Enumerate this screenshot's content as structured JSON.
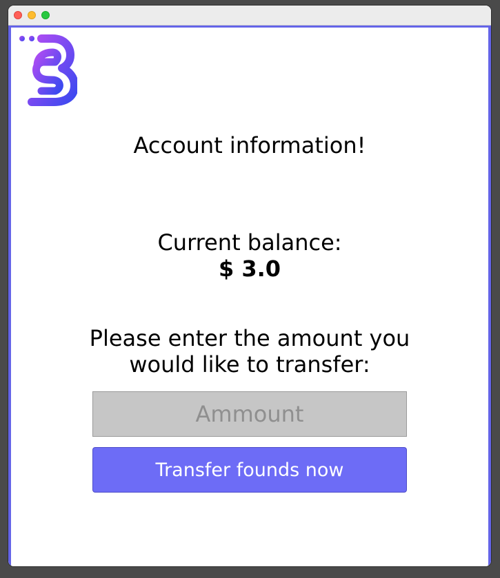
{
  "window": {
    "controls": [
      "close",
      "minimize",
      "maximize"
    ]
  },
  "logo": {
    "icon": "bank-logo-icon",
    "gradient_start": "#a544f0",
    "gradient_end": "#3b4bf0"
  },
  "header": {
    "title": "Account information!"
  },
  "balance": {
    "label": "Current balance:",
    "value": "$ 3.0"
  },
  "transfer": {
    "prompt_line1": "Please enter the amount you",
    "prompt_line2": "would like to transfer:",
    "amount_placeholder": "Ammount",
    "amount_value": "",
    "button_label": "Transfer founds now"
  },
  "colors": {
    "accent": "#6d6cf6",
    "frame": "#6464e8",
    "input_bg": "#c6c6c6"
  }
}
